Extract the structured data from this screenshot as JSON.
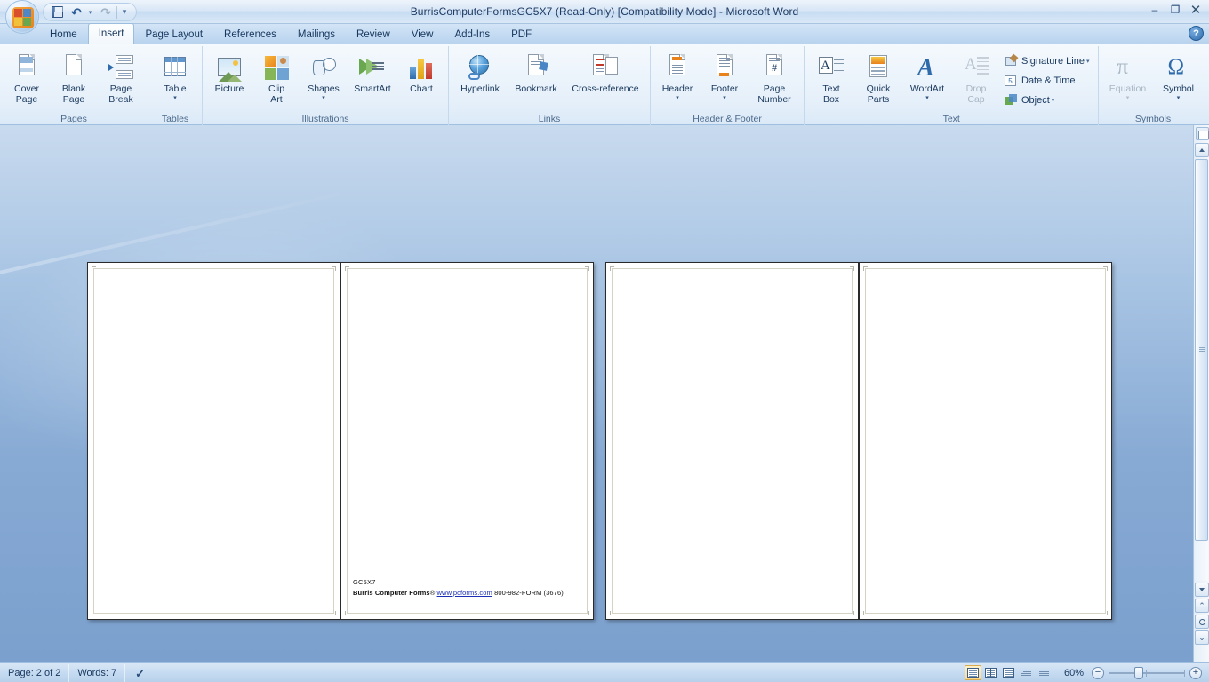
{
  "window": {
    "title": "BurrisComputerFormsGC5X7 (Read-Only) [Compatibility Mode]  -  Microsoft Word",
    "minimize_label": "–",
    "restore_label": "❐",
    "close_label": "✕",
    "help_label": "?"
  },
  "quick_access": {
    "save_tooltip": "Save",
    "undo_glyph": "↶",
    "undo_caret": "▾",
    "redo_glyph": "↷",
    "customize_glyph": "≡",
    "customize_caret": "▾"
  },
  "tabs": [
    {
      "label": "Home",
      "active": false
    },
    {
      "label": "Insert",
      "active": true
    },
    {
      "label": "Page Layout",
      "active": false
    },
    {
      "label": "References",
      "active": false
    },
    {
      "label": "Mailings",
      "active": false
    },
    {
      "label": "Review",
      "active": false
    },
    {
      "label": "View",
      "active": false
    },
    {
      "label": "Add-Ins",
      "active": false
    },
    {
      "label": "PDF",
      "active": false
    }
  ],
  "ribbon": {
    "groups": {
      "pages": {
        "label": "Pages",
        "cover_page": "Cover\nPage",
        "cover_page_l1": "Cover",
        "cover_page_l2": "Page",
        "blank_page_l1": "Blank",
        "blank_page_l2": "Page",
        "page_break_l1": "Page",
        "page_break_l2": "Break"
      },
      "tables": {
        "label": "Tables",
        "table": "Table"
      },
      "illustrations": {
        "label": "Illustrations",
        "picture": "Picture",
        "clip_art_l1": "Clip",
        "clip_art_l2": "Art",
        "shapes": "Shapes",
        "smartart": "SmartArt",
        "chart": "Chart"
      },
      "links": {
        "label": "Links",
        "hyperlink": "Hyperlink",
        "bookmark": "Bookmark",
        "cross_reference": "Cross-reference"
      },
      "header_footer": {
        "label": "Header & Footer",
        "header": "Header",
        "footer": "Footer",
        "page_number_l1": "Page",
        "page_number_l2": "Number"
      },
      "text": {
        "label": "Text",
        "text_box_l1": "Text",
        "text_box_l2": "Box",
        "quick_parts_l1": "Quick",
        "quick_parts_l2": "Parts",
        "wordart": "WordArt",
        "drop_cap_l1": "Drop",
        "drop_cap_l2": "Cap",
        "signature_line": "Signature Line",
        "date_time": "Date & Time",
        "object": "Object",
        "date_glyph": "5"
      },
      "symbols": {
        "label": "Symbols",
        "equation": "Equation",
        "equation_glyph": "π",
        "symbol": "Symbol",
        "symbol_glyph": "Ω"
      }
    },
    "caret": "▾"
  },
  "document": {
    "page_spreads": 2,
    "text_block": {
      "line1": "GC5X7",
      "line2_prefix": "Burris Computer Forms",
      "line2_reg": "®",
      "line2_link": "www.pcforms.com",
      "line2_suffix": "800-982-FORM (3676)"
    }
  },
  "scrollbar": {
    "select_browse_object": "Select Browse Object",
    "previous_page": "▲",
    "next_page": "▼",
    "up_arrow": "▲",
    "down_arrow": "▼"
  },
  "statusbar": {
    "page": "Page: 2 of 2",
    "words": "Words: 7",
    "proofing_tooltip": "Proofing errors",
    "zoom_level": "60%",
    "zoom_out": "−",
    "zoom_in": "+",
    "views": [
      {
        "name": "print-layout",
        "active": true
      },
      {
        "name": "full-screen-reading",
        "active": false
      },
      {
        "name": "web-layout",
        "active": false
      },
      {
        "name": "outline",
        "active": false
      },
      {
        "name": "draft",
        "active": false
      }
    ]
  },
  "colors": {
    "accent": "#2f6bab",
    "ribbon_bg": "#e6f0fa",
    "doc_bg": "#87aad4",
    "link": "#1a2fb4"
  }
}
